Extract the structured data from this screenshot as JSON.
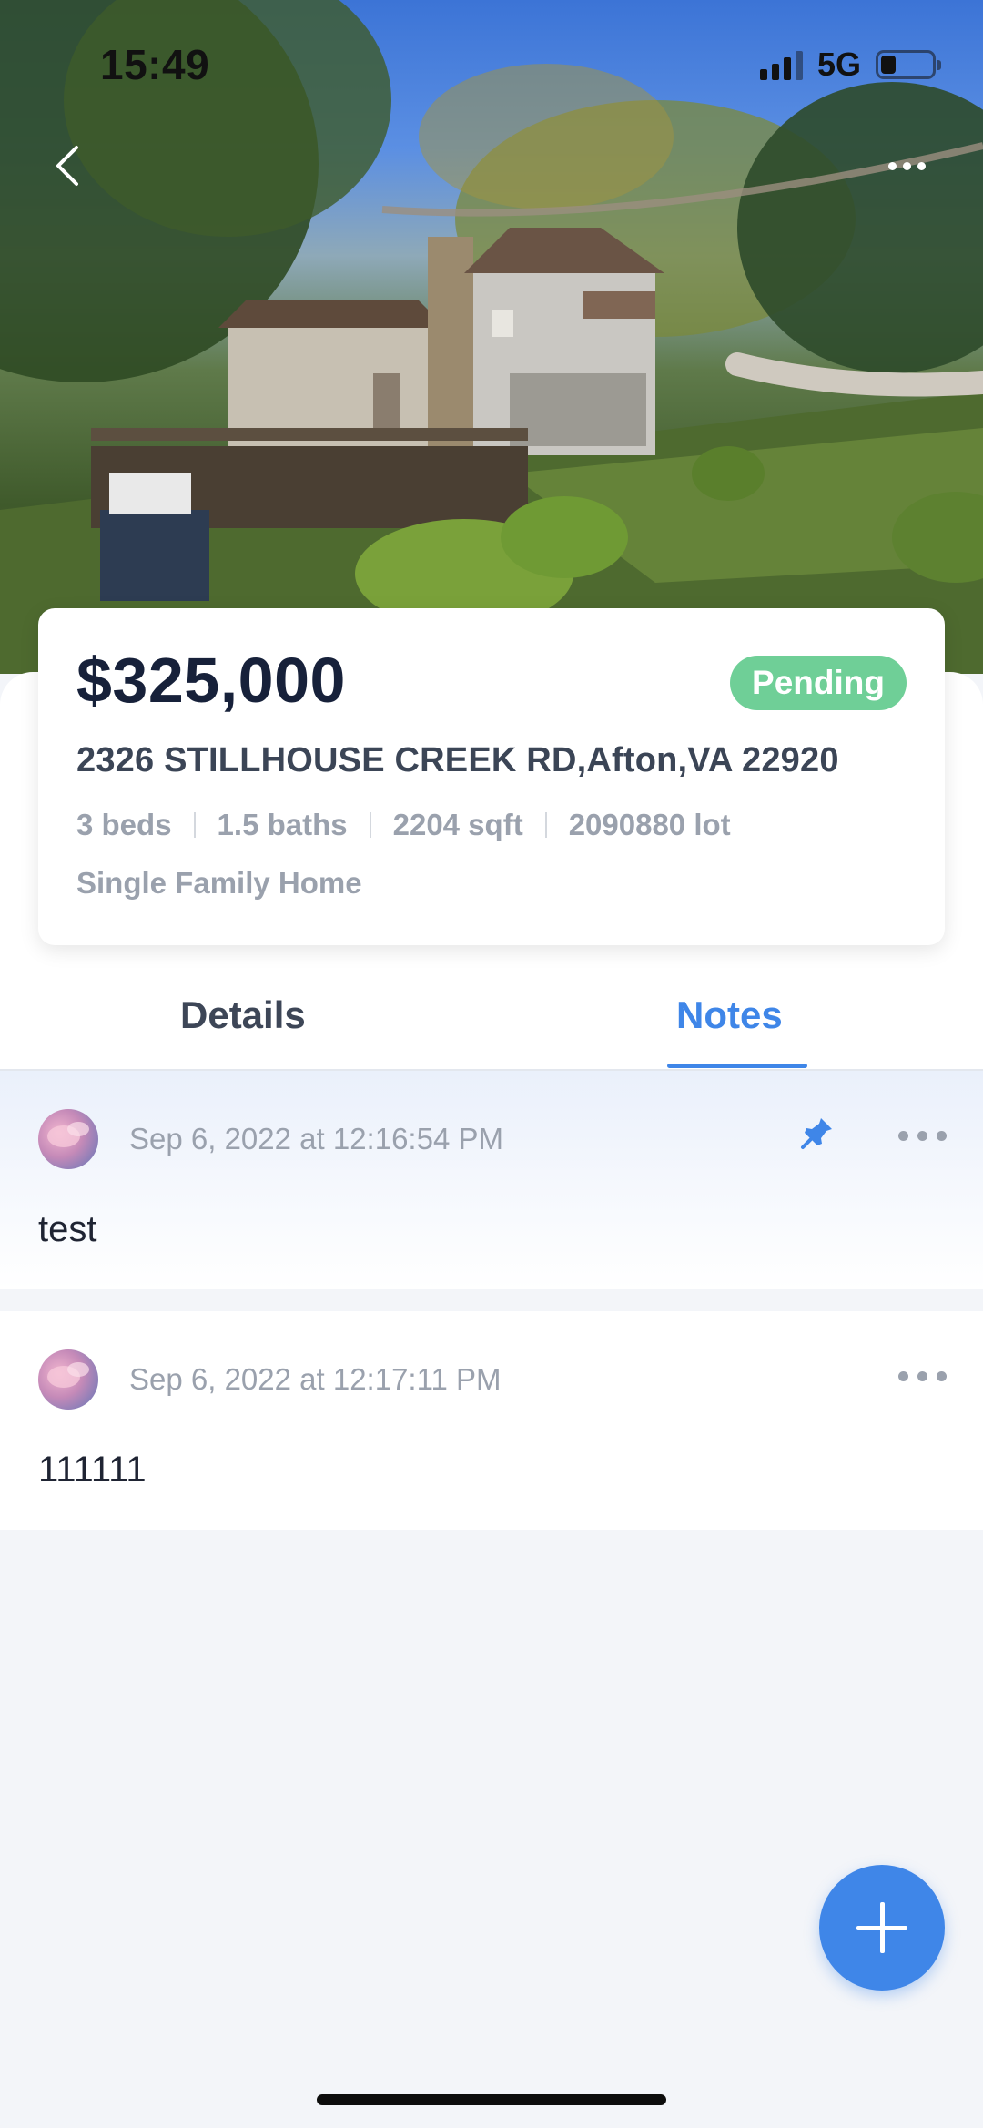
{
  "status_bar": {
    "time": "15:49",
    "network": "5G"
  },
  "listing": {
    "price": "$325,000",
    "status": "Pending",
    "address": "2326 STILLHOUSE CREEK RD,Afton,VA 22920",
    "specs": [
      "3 beds",
      "1.5 baths",
      "2204 sqft",
      "2090880 lot"
    ],
    "property_type": "Single Family Home"
  },
  "tabs": [
    {
      "label": "Details",
      "active": false
    },
    {
      "label": "Notes",
      "active": true
    }
  ],
  "notes": [
    {
      "date": "Sep 6, 2022 at 12:16:54 PM",
      "text": "test",
      "pinned": true
    },
    {
      "date": "Sep 6, 2022 at 12:17:11 PM",
      "text": "111111",
      "pinned": false
    }
  ],
  "colors": {
    "accent": "#3f86e8",
    "status_badge": "#6fcf97",
    "price_text": "#17213a"
  },
  "icons": {
    "back": "chevron-left-icon",
    "more": "more-horizontal-icon",
    "pin": "pin-icon",
    "add": "plus-icon"
  }
}
